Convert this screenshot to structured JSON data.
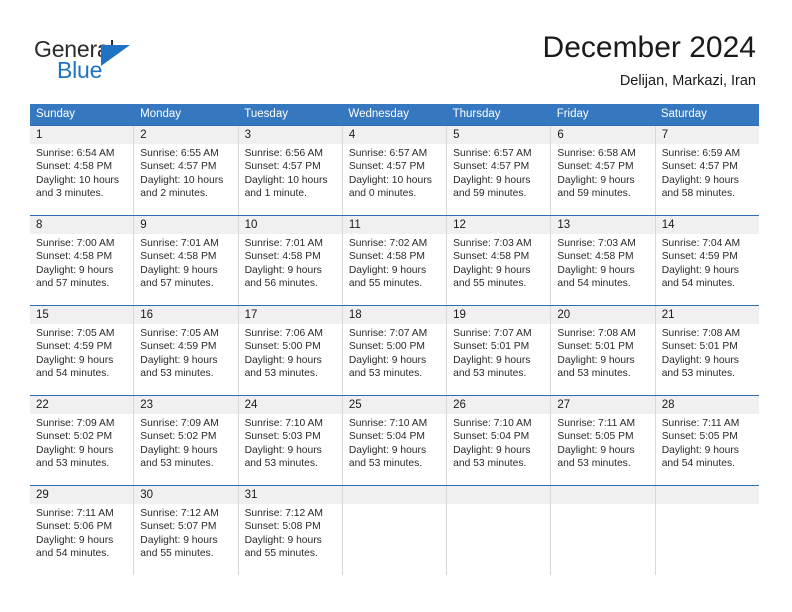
{
  "brand": {
    "name_part1": "General",
    "name_part2": "Blue",
    "colors": {
      "blue": "#1f73c4",
      "dark": "#2b2b2b"
    }
  },
  "header": {
    "title": "December 2024",
    "subtitle": "Delijan, Markazi, Iran"
  },
  "calendar": {
    "header_bg": "#3678bf",
    "row_divider": "#2f6cb0",
    "daynum_band": "#f0f0f0",
    "weekdays": [
      "Sunday",
      "Monday",
      "Tuesday",
      "Wednesday",
      "Thursday",
      "Friday",
      "Saturday"
    ],
    "weeks": [
      [
        {
          "day": "1",
          "sunrise": "Sunrise: 6:54 AM",
          "sunset": "Sunset: 4:58 PM",
          "daylight_line1": "Daylight: 10 hours",
          "daylight_line2": "and 3 minutes."
        },
        {
          "day": "2",
          "sunrise": "Sunrise: 6:55 AM",
          "sunset": "Sunset: 4:57 PM",
          "daylight_line1": "Daylight: 10 hours",
          "daylight_line2": "and 2 minutes."
        },
        {
          "day": "3",
          "sunrise": "Sunrise: 6:56 AM",
          "sunset": "Sunset: 4:57 PM",
          "daylight_line1": "Daylight: 10 hours",
          "daylight_line2": "and 1 minute."
        },
        {
          "day": "4",
          "sunrise": "Sunrise: 6:57 AM",
          "sunset": "Sunset: 4:57 PM",
          "daylight_line1": "Daylight: 10 hours",
          "daylight_line2": "and 0 minutes."
        },
        {
          "day": "5",
          "sunrise": "Sunrise: 6:57 AM",
          "sunset": "Sunset: 4:57 PM",
          "daylight_line1": "Daylight: 9 hours",
          "daylight_line2": "and 59 minutes."
        },
        {
          "day": "6",
          "sunrise": "Sunrise: 6:58 AM",
          "sunset": "Sunset: 4:57 PM",
          "daylight_line1": "Daylight: 9 hours",
          "daylight_line2": "and 59 minutes."
        },
        {
          "day": "7",
          "sunrise": "Sunrise: 6:59 AM",
          "sunset": "Sunset: 4:57 PM",
          "daylight_line1": "Daylight: 9 hours",
          "daylight_line2": "and 58 minutes."
        }
      ],
      [
        {
          "day": "8",
          "sunrise": "Sunrise: 7:00 AM",
          "sunset": "Sunset: 4:58 PM",
          "daylight_line1": "Daylight: 9 hours",
          "daylight_line2": "and 57 minutes."
        },
        {
          "day": "9",
          "sunrise": "Sunrise: 7:01 AM",
          "sunset": "Sunset: 4:58 PM",
          "daylight_line1": "Daylight: 9 hours",
          "daylight_line2": "and 57 minutes."
        },
        {
          "day": "10",
          "sunrise": "Sunrise: 7:01 AM",
          "sunset": "Sunset: 4:58 PM",
          "daylight_line1": "Daylight: 9 hours",
          "daylight_line2": "and 56 minutes."
        },
        {
          "day": "11",
          "sunrise": "Sunrise: 7:02 AM",
          "sunset": "Sunset: 4:58 PM",
          "daylight_line1": "Daylight: 9 hours",
          "daylight_line2": "and 55 minutes."
        },
        {
          "day": "12",
          "sunrise": "Sunrise: 7:03 AM",
          "sunset": "Sunset: 4:58 PM",
          "daylight_line1": "Daylight: 9 hours",
          "daylight_line2": "and 55 minutes."
        },
        {
          "day": "13",
          "sunrise": "Sunrise: 7:03 AM",
          "sunset": "Sunset: 4:58 PM",
          "daylight_line1": "Daylight: 9 hours",
          "daylight_line2": "and 54 minutes."
        },
        {
          "day": "14",
          "sunrise": "Sunrise: 7:04 AM",
          "sunset": "Sunset: 4:59 PM",
          "daylight_line1": "Daylight: 9 hours",
          "daylight_line2": "and 54 minutes."
        }
      ],
      [
        {
          "day": "15",
          "sunrise": "Sunrise: 7:05 AM",
          "sunset": "Sunset: 4:59 PM",
          "daylight_line1": "Daylight: 9 hours",
          "daylight_line2": "and 54 minutes."
        },
        {
          "day": "16",
          "sunrise": "Sunrise: 7:05 AM",
          "sunset": "Sunset: 4:59 PM",
          "daylight_line1": "Daylight: 9 hours",
          "daylight_line2": "and 53 minutes."
        },
        {
          "day": "17",
          "sunrise": "Sunrise: 7:06 AM",
          "sunset": "Sunset: 5:00 PM",
          "daylight_line1": "Daylight: 9 hours",
          "daylight_line2": "and 53 minutes."
        },
        {
          "day": "18",
          "sunrise": "Sunrise: 7:07 AM",
          "sunset": "Sunset: 5:00 PM",
          "daylight_line1": "Daylight: 9 hours",
          "daylight_line2": "and 53 minutes."
        },
        {
          "day": "19",
          "sunrise": "Sunrise: 7:07 AM",
          "sunset": "Sunset: 5:01 PM",
          "daylight_line1": "Daylight: 9 hours",
          "daylight_line2": "and 53 minutes."
        },
        {
          "day": "20",
          "sunrise": "Sunrise: 7:08 AM",
          "sunset": "Sunset: 5:01 PM",
          "daylight_line1": "Daylight: 9 hours",
          "daylight_line2": "and 53 minutes."
        },
        {
          "day": "21",
          "sunrise": "Sunrise: 7:08 AM",
          "sunset": "Sunset: 5:01 PM",
          "daylight_line1": "Daylight: 9 hours",
          "daylight_line2": "and 53 minutes."
        }
      ],
      [
        {
          "day": "22",
          "sunrise": "Sunrise: 7:09 AM",
          "sunset": "Sunset: 5:02 PM",
          "daylight_line1": "Daylight: 9 hours",
          "daylight_line2": "and 53 minutes."
        },
        {
          "day": "23",
          "sunrise": "Sunrise: 7:09 AM",
          "sunset": "Sunset: 5:02 PM",
          "daylight_line1": "Daylight: 9 hours",
          "daylight_line2": "and 53 minutes."
        },
        {
          "day": "24",
          "sunrise": "Sunrise: 7:10 AM",
          "sunset": "Sunset: 5:03 PM",
          "daylight_line1": "Daylight: 9 hours",
          "daylight_line2": "and 53 minutes."
        },
        {
          "day": "25",
          "sunrise": "Sunrise: 7:10 AM",
          "sunset": "Sunset: 5:04 PM",
          "daylight_line1": "Daylight: 9 hours",
          "daylight_line2": "and 53 minutes."
        },
        {
          "day": "26",
          "sunrise": "Sunrise: 7:10 AM",
          "sunset": "Sunset: 5:04 PM",
          "daylight_line1": "Daylight: 9 hours",
          "daylight_line2": "and 53 minutes."
        },
        {
          "day": "27",
          "sunrise": "Sunrise: 7:11 AM",
          "sunset": "Sunset: 5:05 PM",
          "daylight_line1": "Daylight: 9 hours",
          "daylight_line2": "and 53 minutes."
        },
        {
          "day": "28",
          "sunrise": "Sunrise: 7:11 AM",
          "sunset": "Sunset: 5:05 PM",
          "daylight_line1": "Daylight: 9 hours",
          "daylight_line2": "and 54 minutes."
        }
      ],
      [
        {
          "day": "29",
          "sunrise": "Sunrise: 7:11 AM",
          "sunset": "Sunset: 5:06 PM",
          "daylight_line1": "Daylight: 9 hours",
          "daylight_line2": "and 54 minutes."
        },
        {
          "day": "30",
          "sunrise": "Sunrise: 7:12 AM",
          "sunset": "Sunset: 5:07 PM",
          "daylight_line1": "Daylight: 9 hours",
          "daylight_line2": "and 55 minutes."
        },
        {
          "day": "31",
          "sunrise": "Sunrise: 7:12 AM",
          "sunset": "Sunset: 5:08 PM",
          "daylight_line1": "Daylight: 9 hours",
          "daylight_line2": "and 55 minutes."
        },
        {
          "day": "",
          "sunrise": "",
          "sunset": "",
          "daylight_line1": "",
          "daylight_line2": ""
        },
        {
          "day": "",
          "sunrise": "",
          "sunset": "",
          "daylight_line1": "",
          "daylight_line2": ""
        },
        {
          "day": "",
          "sunrise": "",
          "sunset": "",
          "daylight_line1": "",
          "daylight_line2": ""
        },
        {
          "day": "",
          "sunrise": "",
          "sunset": "",
          "daylight_line1": "",
          "daylight_line2": ""
        }
      ]
    ]
  }
}
